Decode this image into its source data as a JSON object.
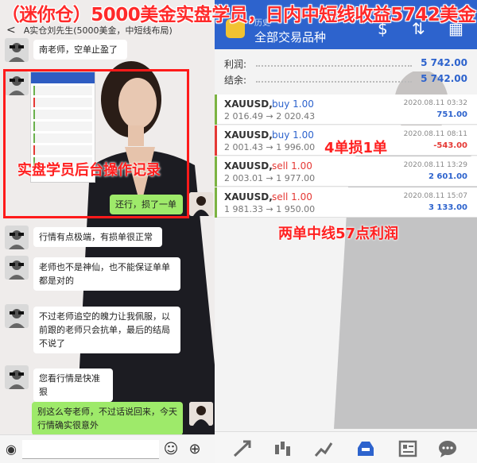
{
  "banner": {
    "text": "（迷你仓）5000美金实盘学员，日内中短线收益5742美金"
  },
  "chat": {
    "header_title": "A实仓刘先生(5000美金，中短线布局)",
    "messages": [
      "南老师，空单止盈了",
      "还行，损了一单",
      "行情有点极端，有损单很正常",
      "老师也不是神仙，也不能保证单单都是对的",
      "不过老师追空的魄力让我佩服，以前跟的老师只会抗单，最后的结局不说了",
      "您看行情是快准狠",
      "别这么夸老师，不过话说回来，今天行情确实很意外"
    ]
  },
  "annotations": {
    "record": "实盘学员后台操作记录",
    "loss": "4单损1单",
    "profit": "两单中线57点利润"
  },
  "mt": {
    "history_label": "历史",
    "title": "全部交易品种",
    "accent": "#2d63cd",
    "summary": [
      {
        "label": "利润:",
        "value": "5 742.00"
      },
      {
        "label": "结余:",
        "value": "5 742.00"
      }
    ],
    "trades": [
      {
        "symbol": "XAUUSD,",
        "dir": "buy 1.00",
        "price": "2 016.49 → 2 020.43",
        "time": "2020.08.11 03:32",
        "pl": "751.00",
        "edge": "green"
      },
      {
        "symbol": "XAUUSD,",
        "dir": "buy 1.00",
        "price": "2 001.43 → 1 996.00",
        "time": "2020.08.11 08:11",
        "pl": "-543.00",
        "edge": "red"
      },
      {
        "symbol": "XAUUSD,",
        "dir": "sell 1.00",
        "price": "2 003.01 → 1 977.00",
        "time": "2020.08.11 13:29",
        "pl": "2 601.00",
        "edge": "green"
      },
      {
        "symbol": "XAUUSD,",
        "dir": "sell 1.00",
        "price": "1 981.33 → 1 950.00",
        "time": "2020.08.11 15:07",
        "pl": "3 133.00",
        "edge": "green"
      }
    ],
    "tabs": [
      "trade-icon",
      "chart-icon",
      "history-icon",
      "inbox-icon",
      "news-icon",
      "chat-icon"
    ]
  }
}
